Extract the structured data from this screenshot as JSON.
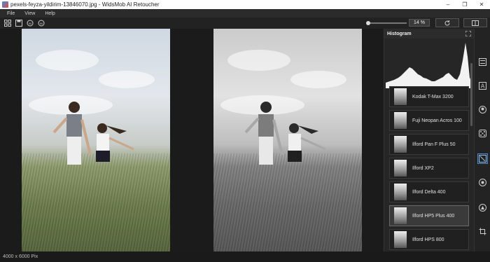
{
  "window": {
    "title": "pexels-feyza-yildirim-13846070.jpg - WidsMob AI Retoucher"
  },
  "menu": {
    "file": "File",
    "view": "View",
    "help": "Help"
  },
  "toolbar": {
    "zoom": "14 %",
    "icons": [
      "grid-icon",
      "save-icon",
      "rotate-left-icon",
      "rotate-right-icon"
    ]
  },
  "panel": {
    "title": "Histogram",
    "presets": [
      {
        "label": "Kodak T-Max 3200"
      },
      {
        "label": "Fuji Neopan Acros 100"
      },
      {
        "label": "Ilford Pan F Plus 50"
      },
      {
        "label": "Ilford XP2"
      },
      {
        "label": "Ilford Delta 400"
      },
      {
        "label": "Ilford HP5 Plus 400"
      },
      {
        "label": "Ilford HPS 800"
      }
    ],
    "selected_preset": "Ilford HP5 Plus 400"
  },
  "status": {
    "dimensions": "4000 x 6000 Pix"
  },
  "colors": {
    "accent": "#4a8fd6",
    "background": "#1e1e1e"
  }
}
